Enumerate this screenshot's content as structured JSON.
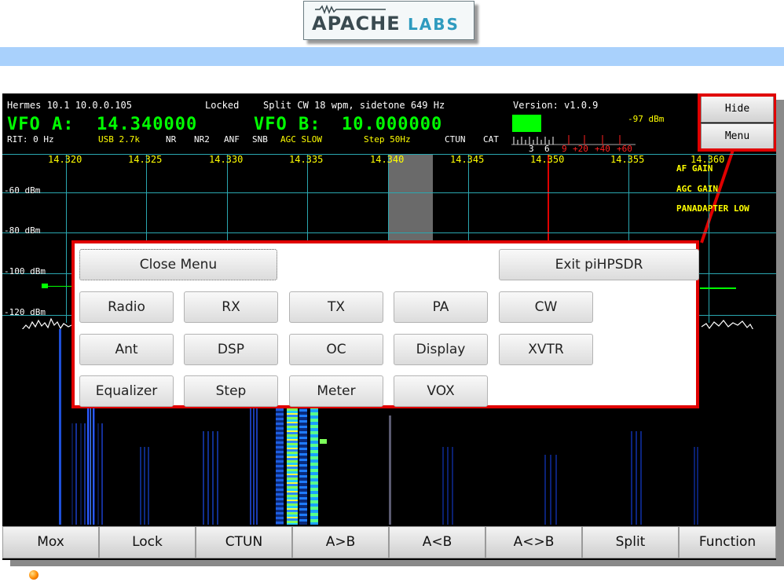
{
  "logo": {
    "word1": "APACHE",
    "word2": "LABS"
  },
  "status": {
    "radio": "Hermes 10.1 10.0.0.105",
    "lock": "Locked",
    "split_info": "Split CW 18 wpm, sidetone 649 Hz",
    "version": "Version: v1.0.9"
  },
  "vfo_a": {
    "label": "VFO A:",
    "freq": "14.340000"
  },
  "vfo_b": {
    "label": "VFO B:",
    "freq": "10.000000"
  },
  "meter": {
    "dbm": "-97 dBm",
    "scale_white": [
      "3",
      "6"
    ],
    "scale_red": [
      "9",
      "+20",
      "+40",
      "+60"
    ],
    "bar_fill": 0.35
  },
  "status_line": {
    "rit": "RIT: 0 Hz",
    "mode": "USB 2.7k",
    "nr": "NR",
    "nr2": "NR2",
    "anf": "ANF",
    "snb": "SNB",
    "agc": "AGC SLOW",
    "step": "Step 50Hz",
    "ctun": "CTUN",
    "cat": "CAT"
  },
  "corner_buttons": {
    "hide": "Hide",
    "menu": "Menu"
  },
  "freq_ticks": [
    "14.320",
    "14.325",
    "14.330",
    "14.335",
    "14.340",
    "14.345",
    "14.350",
    "14.355",
    "14.360"
  ],
  "dbm_labels": [
    "-60 dBm",
    "-80 dBm",
    "-100 dBm",
    "-120 dBm"
  ],
  "side_labels": [
    "AF GAIN",
    "AGC GAIN",
    "PANADAPTER LOW"
  ],
  "menu": {
    "close": "Close Menu",
    "exit": "Exit piHPSDR",
    "rows": [
      [
        "Radio",
        "RX",
        "TX",
        "PA",
        "CW"
      ],
      [
        "Ant",
        "DSP",
        "OC",
        "Display",
        "XVTR"
      ],
      [
        "Equalizer",
        "Step",
        "Meter",
        "VOX"
      ]
    ]
  },
  "bottom_buttons": [
    "Mox",
    "Lock",
    "CTUN",
    "A>B",
    "A<B",
    "A<>B",
    "Split",
    "Function"
  ],
  "colors": {
    "background": "#000000",
    "vfo": "#00ff00",
    "accent_yellow": "#ffff00",
    "grid": "#2aa7b0",
    "highlight_red": "#e00000",
    "band": "#a9d1fc"
  }
}
